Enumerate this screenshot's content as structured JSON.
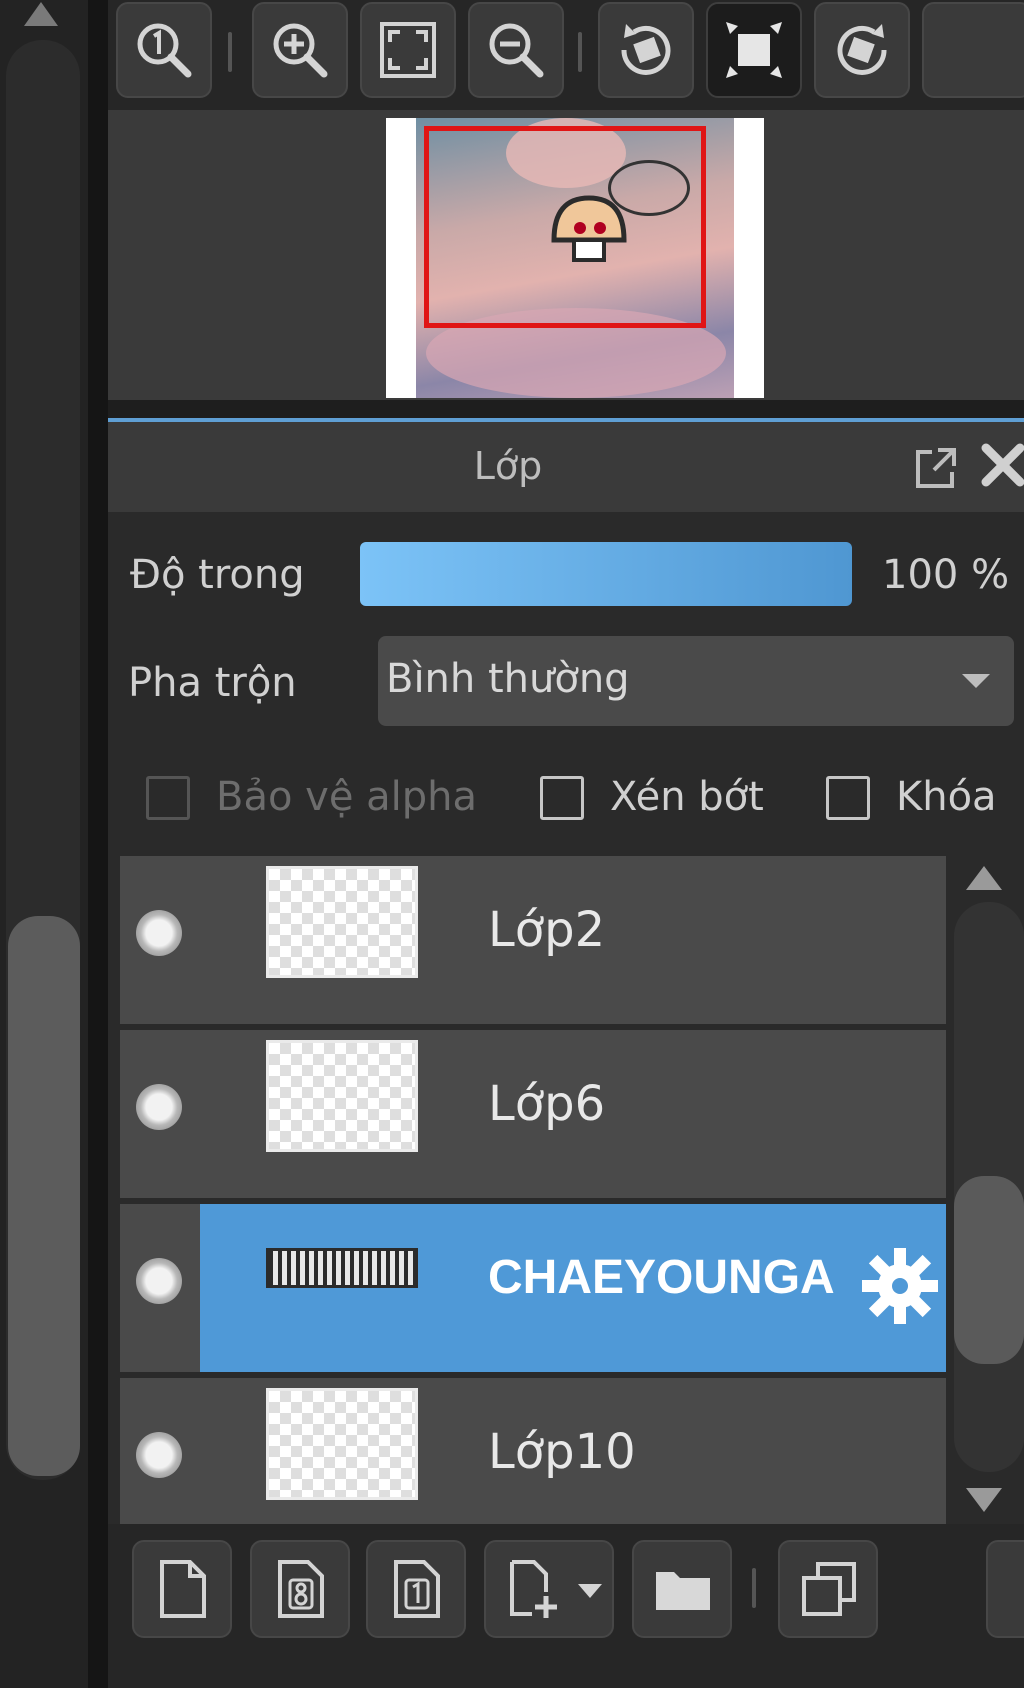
{
  "navigator_toolbar": {
    "buttons": [
      {
        "icon": "zoom-actual-size-icon"
      },
      {
        "icon": "zoom-in-icon"
      },
      {
        "icon": "fit-to-window-icon"
      },
      {
        "icon": "zoom-out-icon"
      },
      {
        "icon": "rotate-left-icon"
      },
      {
        "icon": "fullscreen-icon",
        "active": true
      },
      {
        "icon": "rotate-right-icon"
      }
    ]
  },
  "layer_panel": {
    "title": "Lớp",
    "opacity": {
      "label": "Độ trong",
      "value": 100,
      "display": "100 %"
    },
    "blend": {
      "label": "Pha trộn",
      "value": "Bình thường"
    },
    "checkboxes": {
      "protect_alpha": {
        "label": "Bảo vệ alpha",
        "checked": false,
        "enabled": false
      },
      "clipping": {
        "label": "Xén bớt",
        "checked": false
      },
      "lock": {
        "label": "Khóa",
        "checked": false
      }
    },
    "layers": [
      {
        "name": "Lớp2",
        "visible": true,
        "selected": false
      },
      {
        "name": "Lớp6",
        "visible": true,
        "selected": false
      },
      {
        "name": "CHAEYOUNGA",
        "visible": true,
        "selected": true,
        "type": "text"
      },
      {
        "name": "Lớp10",
        "visible": true,
        "selected": false
      }
    ],
    "accent_color": "#4f99d7"
  },
  "bottom_toolbar": {
    "buttons": [
      {
        "icon": "new-layer-icon"
      },
      {
        "icon": "new-8bit-layer-icon"
      },
      {
        "icon": "new-1bit-layer-icon"
      },
      {
        "icon": "add-layer-menu-icon"
      },
      {
        "icon": "new-folder-icon"
      },
      {
        "icon": "duplicate-layer-icon"
      }
    ]
  }
}
